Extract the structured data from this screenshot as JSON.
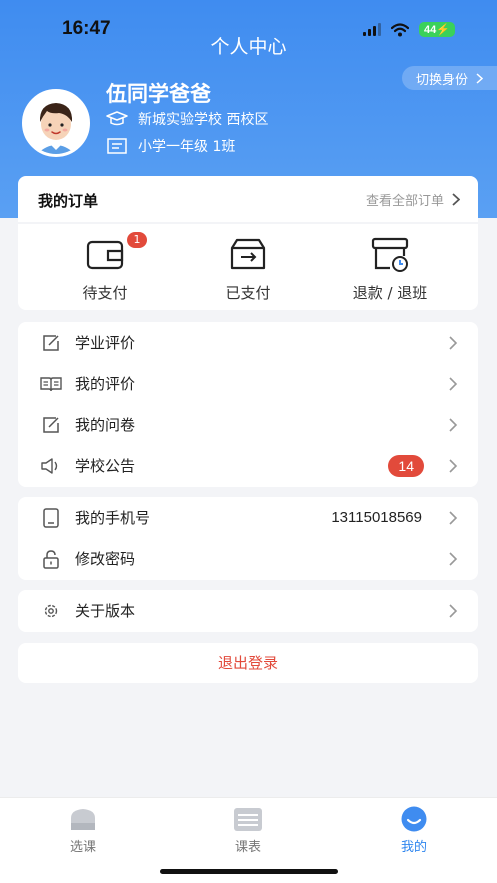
{
  "status_bar": {
    "time": "16:47",
    "battery": "44",
    "icons": [
      "signal-icon",
      "wifi-icon",
      "battery-icon"
    ]
  },
  "page": {
    "title": "个人中心"
  },
  "profile": {
    "name": "伍同学爸爸",
    "school": "新城实验学校 西校区",
    "class": "小学一年级 1班",
    "switch_label": "切换身份"
  },
  "orders": {
    "title": "我的订单",
    "view_all": "查看全部订单",
    "items": [
      {
        "label": "待支付",
        "icon": "wallet-icon",
        "badge": "1"
      },
      {
        "label": "已支付",
        "icon": "paid-box-icon"
      },
      {
        "label": "退款 / 退班",
        "icon": "refund-icon"
      }
    ]
  },
  "menu_group1": [
    {
      "label": "学业评价",
      "icon": "edit-icon"
    },
    {
      "label": "我的评价",
      "icon": "book-icon"
    },
    {
      "label": "我的问卷",
      "icon": "edit-icon"
    },
    {
      "label": "学校公告",
      "icon": "speaker-icon",
      "badge": "14"
    }
  ],
  "menu_group2": [
    {
      "label": "我的手机号",
      "icon": "phone-icon",
      "value": "13115018569"
    },
    {
      "label": "修改密码",
      "icon": "lock-icon"
    }
  ],
  "menu_group3": [
    {
      "label": "关于版本",
      "icon": "gear-icon"
    }
  ],
  "logout_label": "退出登录",
  "tabbar": [
    {
      "label": "选课",
      "icon": "home-icon"
    },
    {
      "label": "课表",
      "icon": "schedule-icon"
    },
    {
      "label": "我的",
      "icon": "profile-face-icon",
      "active": true
    }
  ],
  "colors": {
    "primary": "#3f8cf0",
    "badge": "#e24a3b",
    "active_tab": "#2f86ef"
  }
}
